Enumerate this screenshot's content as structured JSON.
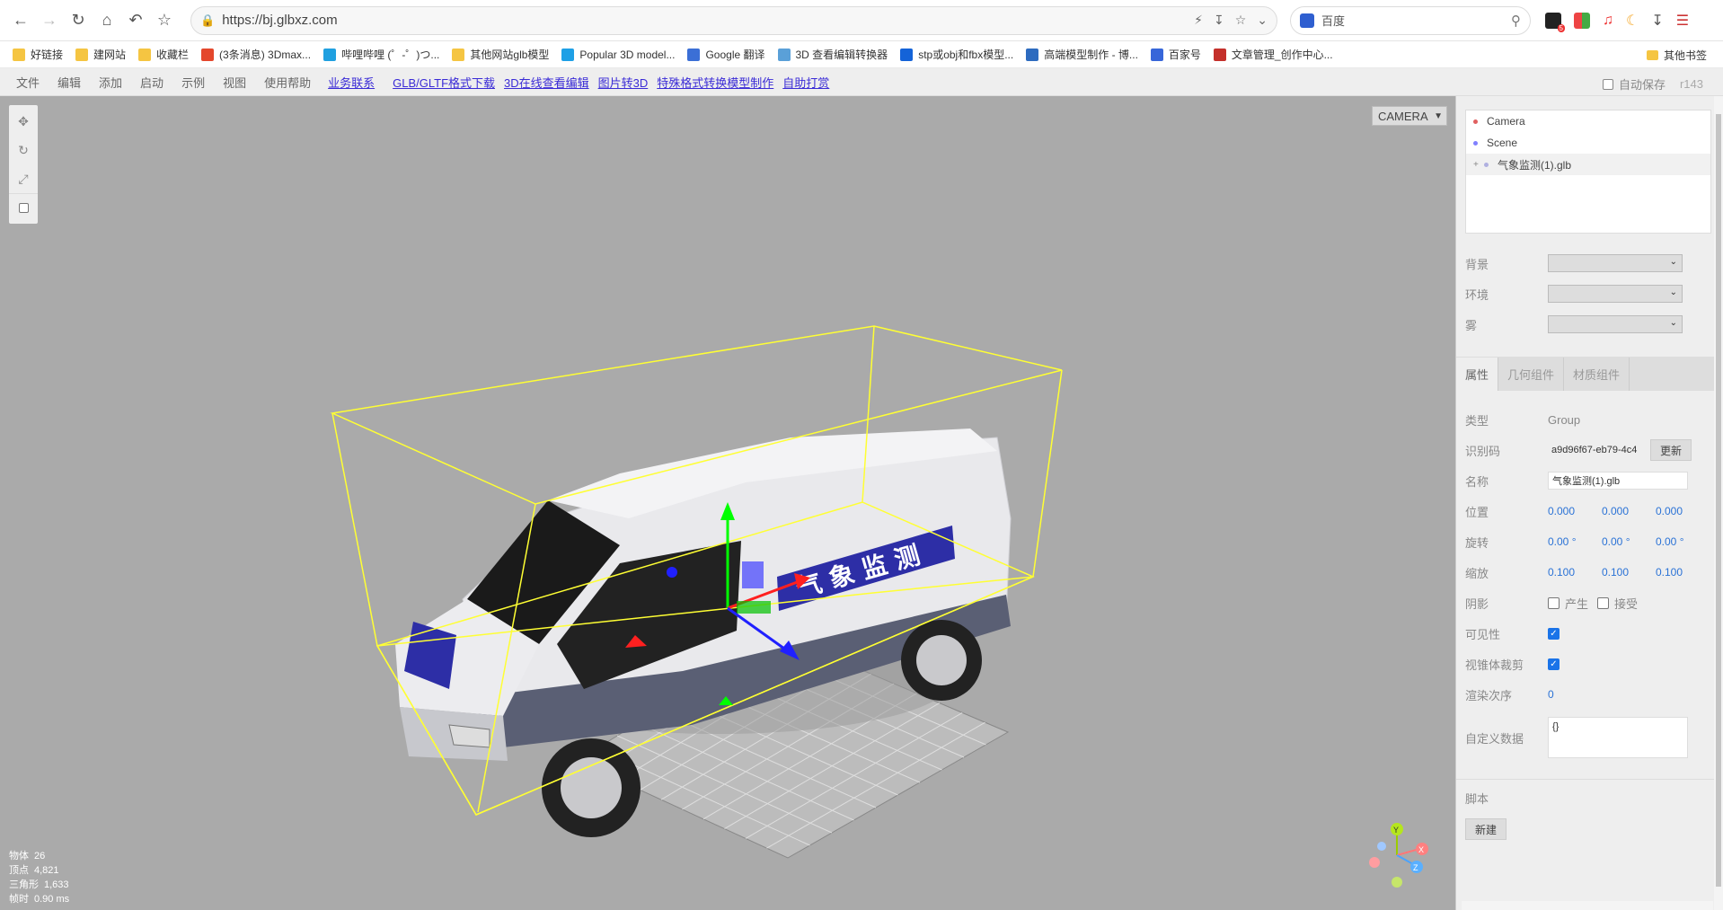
{
  "browser": {
    "url": "https://bj.glbxz.com",
    "search_placeholder": "百度",
    "ext_badge": "5"
  },
  "bookmarks": [
    {
      "label": "好链接",
      "color": "#f5c542"
    },
    {
      "label": "建网站",
      "color": "#f5c542"
    },
    {
      "label": "收藏栏",
      "color": "#f5c542"
    },
    {
      "label": "(3条消息) 3Dmax...",
      "color": "#e4472c"
    },
    {
      "label": "哔哩哔哩 (゜-゜)つ...",
      "color": "#20a0e0"
    },
    {
      "label": "其他网站glb模型",
      "color": "#f5c542"
    },
    {
      "label": "Popular 3D model...",
      "color": "#1ea0e6"
    },
    {
      "label": "Google 翻译",
      "color": "#3b6fd6"
    },
    {
      "label": "3D 查看编辑转换器",
      "color": "#5aa0d8"
    },
    {
      "label": "stp或obj和fbx模型...",
      "color": "#1463d8"
    },
    {
      "label": "高端模型制作 - 博...",
      "color": "#2d6bbf"
    },
    {
      "label": "百家号",
      "color": "#3766d9"
    },
    {
      "label": "文章管理_创作中心...",
      "color": "#c4302b"
    }
  ],
  "bookmarks_other": "其他书签",
  "menubar": {
    "menus": [
      "文件",
      "编辑",
      "添加",
      "启动",
      "示例",
      "视图",
      "使用帮助"
    ],
    "links": [
      "业务联系",
      "GLB/GLTF格式下载",
      "3D在线查看编辑",
      "图片转3D",
      "特殊格式转换模型制作",
      "自助打赏"
    ],
    "autosave": "自动保存",
    "version": "r143"
  },
  "viewport": {
    "camera": "CAMERA",
    "van_text": "气 象 监 测",
    "info": [
      {
        "label": "物体",
        "value": "26"
      },
      {
        "label": "顶点",
        "value": "4,821"
      },
      {
        "label": "三角形",
        "value": "1,633"
      },
      {
        "label": "帧时",
        "value": "0.90 ms"
      }
    ],
    "axes": {
      "x": "X",
      "y": "Y",
      "z": "Z"
    }
  },
  "outliner": [
    {
      "label": "Camera",
      "color": "#e06060"
    },
    {
      "label": "Scene",
      "color": "#8080ff"
    },
    {
      "label": "气象监测(1).glb",
      "color": "#b0b0e0"
    }
  ],
  "scene_props": {
    "background": "背景",
    "environment": "环境",
    "fog": "雾"
  },
  "tabs": [
    "属性",
    "几何组件",
    "材质组件"
  ],
  "props": {
    "type_label": "类型",
    "type_value": "Group",
    "uuid_label": "识别码",
    "uuid_value": "a9d96f67-eb79-4c4",
    "renew": "更新",
    "name_label": "名称",
    "name_value": "气象监测(1).glb",
    "pos_label": "位置",
    "pos": [
      "0.000",
      "0.000",
      "0.000"
    ],
    "rot_label": "旋转",
    "rot": [
      "0.00 °",
      "0.00 °",
      "0.00 °"
    ],
    "scale_label": "缩放",
    "scale": [
      "0.100",
      "0.100",
      "0.100"
    ],
    "shadow_label": "阴影",
    "cast": "产生",
    "receive": "接受",
    "visible_label": "可见性",
    "frustum_label": "视锥体裁剪",
    "order_label": "渲染次序",
    "order_value": "0",
    "userdata_label": "自定义数据",
    "userdata_value": "{}",
    "script_label": "脚本",
    "new_script": "新建"
  }
}
